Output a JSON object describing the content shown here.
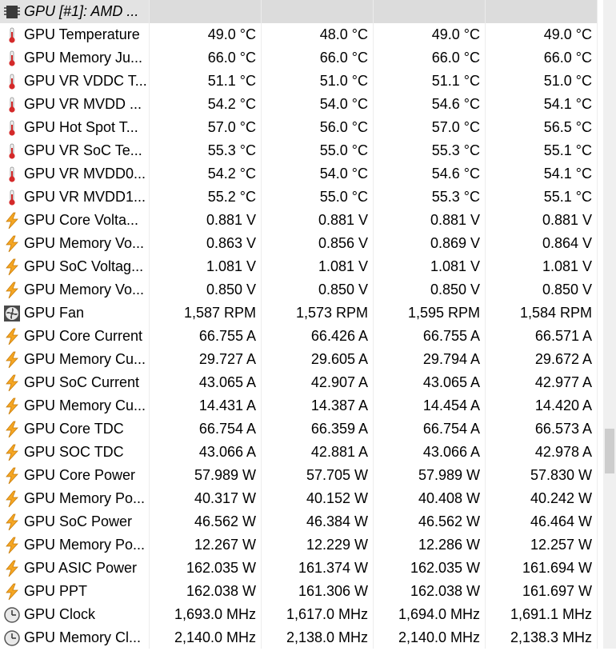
{
  "group_header": "GPU [#1]: AMD ...",
  "scroll_fraction": 0.67,
  "colors": {
    "header_bg": "#e3e3e3",
    "thermo_red": "#d42a2a",
    "bolt_orange": "#f5a623"
  },
  "rows": [
    {
      "name": "GPU Temperature",
      "icon": "thermometer-icon",
      "v": [
        "49.0 °C",
        "48.0 °C",
        "49.0 °C",
        "49.0 °C"
      ]
    },
    {
      "name": "GPU Memory Ju...",
      "icon": "thermometer-icon",
      "v": [
        "66.0 °C",
        "66.0 °C",
        "66.0 °C",
        "66.0 °C"
      ]
    },
    {
      "name": "GPU VR VDDC T...",
      "icon": "thermometer-icon",
      "v": [
        "51.1 °C",
        "51.0 °C",
        "51.1 °C",
        "51.0 °C"
      ]
    },
    {
      "name": "GPU VR MVDD ...",
      "icon": "thermometer-icon",
      "v": [
        "54.2 °C",
        "54.0 °C",
        "54.6 °C",
        "54.1 °C"
      ]
    },
    {
      "name": "GPU Hot Spot T...",
      "icon": "thermometer-icon",
      "v": [
        "57.0 °C",
        "56.0 °C",
        "57.0 °C",
        "56.5 °C"
      ]
    },
    {
      "name": "GPU VR SoC Te...",
      "icon": "thermometer-icon",
      "v": [
        "55.3 °C",
        "55.0 °C",
        "55.3 °C",
        "55.1 °C"
      ]
    },
    {
      "name": "GPU VR MVDD0...",
      "icon": "thermometer-icon",
      "v": [
        "54.2 °C",
        "54.0 °C",
        "54.6 °C",
        "54.1 °C"
      ]
    },
    {
      "name": "GPU VR MVDD1...",
      "icon": "thermometer-icon",
      "v": [
        "55.2 °C",
        "55.0 °C",
        "55.3 °C",
        "55.1 °C"
      ]
    },
    {
      "name": "GPU Core Volta...",
      "icon": "lightning-icon",
      "v": [
        "0.881 V",
        "0.881 V",
        "0.881 V",
        "0.881 V"
      ]
    },
    {
      "name": "GPU Memory Vo...",
      "icon": "lightning-icon",
      "v": [
        "0.863 V",
        "0.856 V",
        "0.869 V",
        "0.864 V"
      ]
    },
    {
      "name": "GPU SoC Voltag...",
      "icon": "lightning-icon",
      "v": [
        "1.081 V",
        "1.081 V",
        "1.081 V",
        "1.081 V"
      ]
    },
    {
      "name": "GPU Memory Vo...",
      "icon": "lightning-icon",
      "v": [
        "0.850 V",
        "0.850 V",
        "0.850 V",
        "0.850 V"
      ]
    },
    {
      "name": "GPU Fan",
      "icon": "fan-icon",
      "v": [
        "1,587 RPM",
        "1,573 RPM",
        "1,595 RPM",
        "1,584 RPM"
      ]
    },
    {
      "name": "GPU Core Current",
      "icon": "lightning-icon",
      "v": [
        "66.755 A",
        "66.426 A",
        "66.755 A",
        "66.571 A"
      ]
    },
    {
      "name": "GPU Memory Cu...",
      "icon": "lightning-icon",
      "v": [
        "29.727 A",
        "29.605 A",
        "29.794 A",
        "29.672 A"
      ]
    },
    {
      "name": "GPU SoC Current",
      "icon": "lightning-icon",
      "v": [
        "43.065 A",
        "42.907 A",
        "43.065 A",
        "42.977 A"
      ]
    },
    {
      "name": "GPU Memory Cu...",
      "icon": "lightning-icon",
      "v": [
        "14.431 A",
        "14.387 A",
        "14.454 A",
        "14.420 A"
      ]
    },
    {
      "name": "GPU Core TDC",
      "icon": "lightning-icon",
      "v": [
        "66.754 A",
        "66.359 A",
        "66.754 A",
        "66.573 A"
      ]
    },
    {
      "name": "GPU SOC TDC",
      "icon": "lightning-icon",
      "v": [
        "43.066 A",
        "42.881 A",
        "43.066 A",
        "42.978 A"
      ]
    },
    {
      "name": "GPU Core Power",
      "icon": "lightning-icon",
      "v": [
        "57.989 W",
        "57.705 W",
        "57.989 W",
        "57.830 W"
      ]
    },
    {
      "name": "GPU Memory Po...",
      "icon": "lightning-icon",
      "v": [
        "40.317 W",
        "40.152 W",
        "40.408 W",
        "40.242 W"
      ]
    },
    {
      "name": "GPU SoC Power",
      "icon": "lightning-icon",
      "v": [
        "46.562 W",
        "46.384 W",
        "46.562 W",
        "46.464 W"
      ]
    },
    {
      "name": "GPU Memory Po...",
      "icon": "lightning-icon",
      "v": [
        "12.267 W",
        "12.229 W",
        "12.286 W",
        "12.257 W"
      ]
    },
    {
      "name": "GPU ASIC Power",
      "icon": "lightning-icon",
      "v": [
        "162.035 W",
        "161.374 W",
        "162.035 W",
        "161.694 W"
      ]
    },
    {
      "name": "GPU PPT",
      "icon": "lightning-icon",
      "v": [
        "162.038 W",
        "161.306 W",
        "162.038 W",
        "161.697 W"
      ]
    },
    {
      "name": "GPU Clock",
      "icon": "clock-icon",
      "v": [
        "1,693.0 MHz",
        "1,617.0 MHz",
        "1,694.0 MHz",
        "1,691.1 MHz"
      ]
    },
    {
      "name": "GPU Memory Cl...",
      "icon": "clock-icon",
      "v": [
        "2,140.0 MHz",
        "2,138.0 MHz",
        "2,140.0 MHz",
        "2,138.3 MHz"
      ]
    }
  ]
}
